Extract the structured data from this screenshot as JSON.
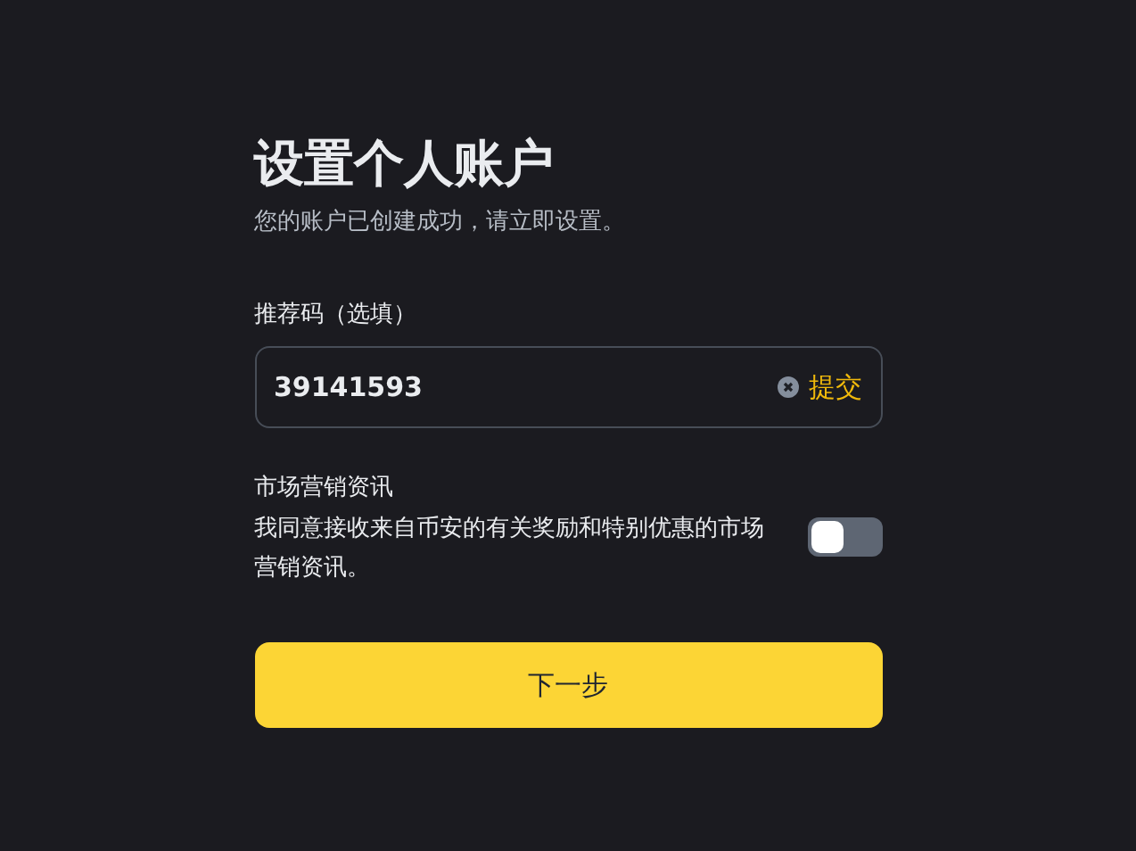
{
  "title": "设置个人账户",
  "subtitle": "您的账户已创建成功，请立即设置。",
  "referral": {
    "label": "推荐码（选填）",
    "value": "39141593",
    "submit": "提交"
  },
  "marketing": {
    "title": "市场营销资讯",
    "text": "我同意接收来自币安的有关奖励和特别优惠的市场营销资讯。",
    "on": false
  },
  "next_button": "下一步"
}
